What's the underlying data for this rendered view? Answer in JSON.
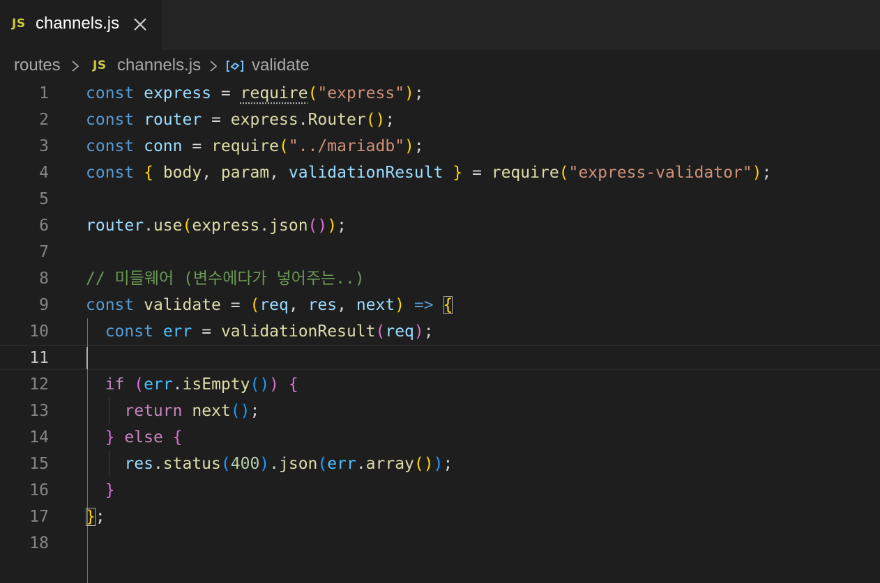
{
  "tab": {
    "badge": "JS",
    "title": "channels.js",
    "close_icon": "close-icon"
  },
  "breadcrumb": {
    "folder": "routes",
    "file_badge": "JS",
    "file": "channels.js",
    "symbol_icon": "symbol-variable-icon",
    "symbol": "validate"
  },
  "editor": {
    "active_line": 11,
    "line_numbers": [
      "1",
      "2",
      "3",
      "4",
      "5",
      "6",
      "7",
      "8",
      "9",
      "10",
      "11",
      "12",
      "13",
      "14",
      "15",
      "16",
      "17",
      "18"
    ],
    "code": {
      "l1": [
        "const",
        "express",
        "require",
        "\"express\""
      ],
      "l2": [
        "const",
        "router",
        "express",
        "Router"
      ],
      "l3": [
        "const",
        "conn",
        "require",
        "\"../mariadb\""
      ],
      "l4": [
        "const",
        "body",
        "param",
        "validationResult",
        "require",
        "\"express-validator\""
      ],
      "l6": [
        "router",
        "use",
        "express",
        "json"
      ],
      "l8": "// 미들웨어 (변수에다가 넣어주는..)",
      "l9": [
        "const",
        "validate",
        "req",
        "res",
        "next"
      ],
      "l10": [
        "const",
        "err",
        "validationResult",
        "req"
      ],
      "l12": [
        "if",
        "err",
        "isEmpty"
      ],
      "l13": [
        "return",
        "next"
      ],
      "l14": [
        "else"
      ],
      "l15": [
        "res",
        "status",
        "400",
        "json",
        "err",
        "array"
      ]
    }
  },
  "colors": {
    "background": "#1e1e1e",
    "tabbar": "#252526",
    "keyword": "#569cd6",
    "control": "#c586c0",
    "variable": "#9cdcfe",
    "function": "#dcdcaa",
    "string": "#ce9178",
    "number": "#b5cea8",
    "comment": "#6a9955",
    "js_badge": "#cbcb41"
  }
}
